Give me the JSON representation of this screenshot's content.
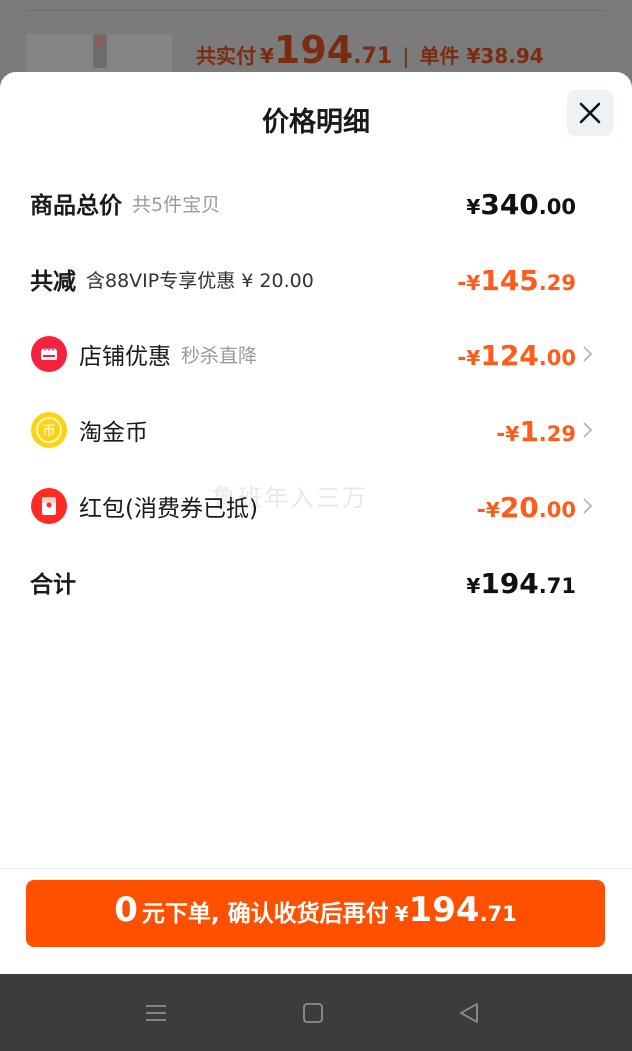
{
  "background": {
    "price_label": "共实付",
    "price_yen": "¥",
    "price_int": "194",
    "price_dec": ".71",
    "separator": "|",
    "unit_label": "单件 ¥38.94"
  },
  "sheet": {
    "title": "价格明细",
    "close_icon": "close-icon",
    "rows": {
      "total": {
        "label": "商品总价",
        "sub": "共5件宝贝",
        "sign": "",
        "yen": "¥",
        "int": "340",
        "dec": ".00"
      },
      "reduce": {
        "label": "共减",
        "sub": "含88VIP专享优惠 ¥ 20.00",
        "sign": "-",
        "yen": "¥",
        "int": "145",
        "dec": ".29"
      },
      "shop": {
        "label": "店铺优惠",
        "sub": "秒杀直降",
        "sign": "-",
        "yen": "¥",
        "int": "124",
        "dec": ".00",
        "icon": "shop-icon"
      },
      "coin": {
        "label": "淘金币",
        "sign": "-",
        "yen": "¥",
        "int": "1",
        "dec": ".29",
        "icon": "coin-icon"
      },
      "redpack": {
        "label": "红包(消费券已抵)",
        "sign": "-",
        "yen": "¥",
        "int": "20",
        "dec": ".00",
        "icon": "red-packet-icon"
      },
      "sum": {
        "label": "合计",
        "sign": "",
        "yen": "¥",
        "int": "194",
        "dec": ".71"
      }
    },
    "watermark": "鲁班年入三万"
  },
  "cta": {
    "zero": "0",
    "text": "元下单, 确认收货后再付",
    "yen": "¥",
    "int": "194",
    "dec": ".71"
  },
  "colors": {
    "accent": "#ff5000",
    "discount": "#ff5b1a",
    "text": "#1a1a1a"
  },
  "navbar": {
    "icons": [
      "menu-icon",
      "home-square-icon",
      "back-triangle-icon"
    ]
  }
}
